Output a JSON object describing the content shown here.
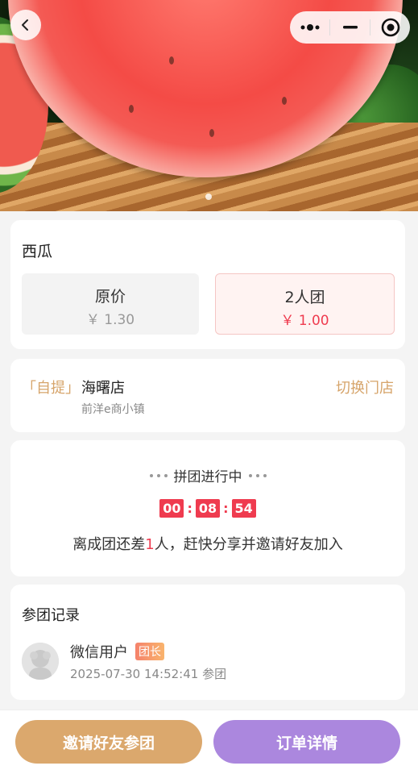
{
  "product": {
    "title": "西瓜",
    "original_label": "原价",
    "original_price": "￥ 1.30",
    "group_label": "2人团",
    "group_price": "￥ 1.00"
  },
  "pickup": {
    "tag": "「自提」",
    "store_name": "海曙店",
    "store_address": "前洋e商小镇",
    "switch_label": "切换门店"
  },
  "group_status": {
    "status": "拼团进行中",
    "countdown": {
      "hours": "00",
      "minutes": "08",
      "seconds": "54"
    },
    "remain_prefix": "离成团还差",
    "remain_count": "1",
    "remain_suffix": "人，赶快分享并邀请好友加入"
  },
  "records": {
    "title": "参团记录",
    "items": [
      {
        "name": "微信用户",
        "badge": "团长",
        "time": "2025-07-30 14:52:41 参团"
      }
    ]
  },
  "actions": {
    "invite_label": "邀请好友参团",
    "order_label": "订单详情"
  },
  "colors": {
    "accent_red": "#ef3b4f",
    "gold": "#d6a46a",
    "invite_button": "#dba86d",
    "order_button": "#ab87de"
  },
  "icons": {
    "back": "chevron-left-icon",
    "menu": "more-dots-icon",
    "minimize": "minimize-icon",
    "close": "target-circle-icon",
    "avatar": "default-user-avatar-icon"
  }
}
